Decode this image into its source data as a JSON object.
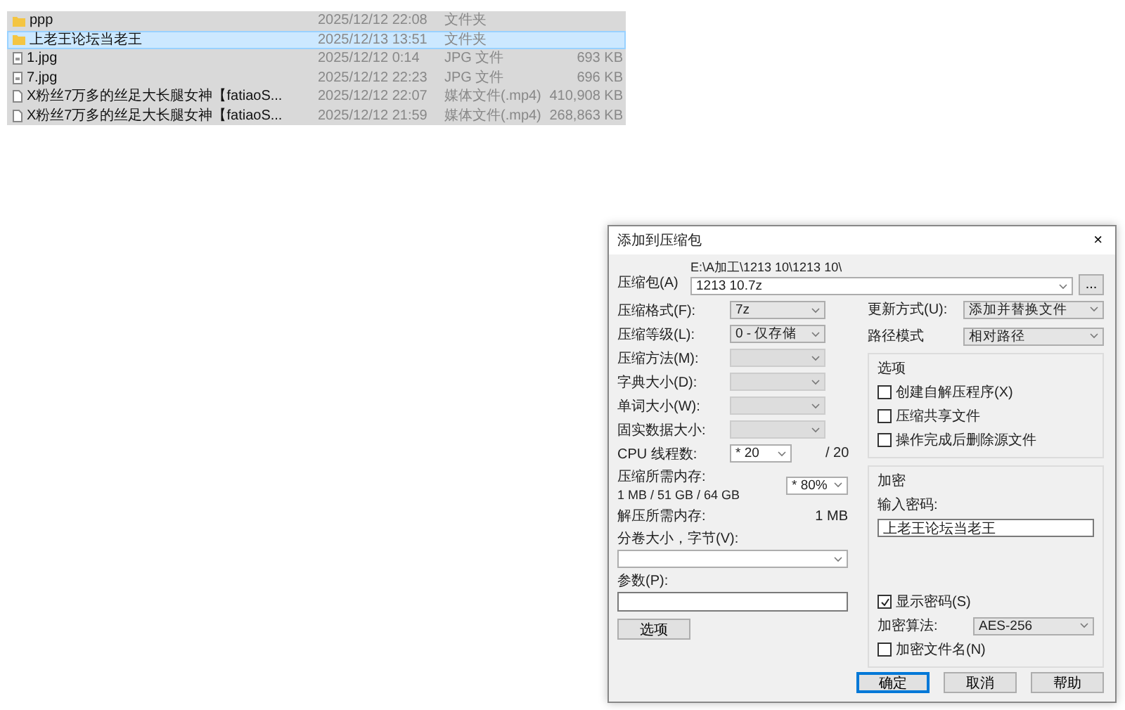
{
  "file_list": {
    "rows": [
      {
        "kind": "folder",
        "name": "ppp",
        "date": "2025/12/12 22:08",
        "type": "文件夹",
        "selected": false
      },
      {
        "kind": "folder",
        "name": "上老王论坛当老王",
        "date": "2025/12/13 13:51",
        "type": "文件夹",
        "selected": true
      },
      {
        "kind": "image",
        "name": "1.jpg",
        "date": "2025/12/12 0:14",
        "type": "JPG 文件",
        "size": "693 KB",
        "selected": false
      },
      {
        "kind": "image",
        "name": "7.jpg",
        "date": "2025/12/12 22:23",
        "type": "JPG 文件",
        "size": "696 KB",
        "selected": false
      },
      {
        "kind": "file",
        "name": "X粉丝7万多的丝足大长腿女神【fatiaoS...",
        "date": "2025/12/12 22:07",
        "type": "媒体文件(.mp4)",
        "size": "410,908 KB",
        "selected": false
      },
      {
        "kind": "file",
        "name": "X粉丝7万多的丝足大长腿女神【fatiaoS...",
        "date": "2025/12/12 21:59",
        "type": "媒体文件(.mp4)",
        "size": "268,863 KB",
        "selected": false
      }
    ]
  },
  "dialog": {
    "title": "添加到压缩包",
    "close": "×",
    "archive": {
      "label": "压缩包(A)",
      "path": "E:\\A加工\\1213 10\\1213 10\\",
      "value": "1213 10.7z",
      "browse": "..."
    },
    "settings": [
      {
        "kind": "combo",
        "label": "压缩格式(F):",
        "value": "7z",
        "disabled": false
      },
      {
        "kind": "combo",
        "label": "压缩等级(L):",
        "value": "0 - 仅存储",
        "disabled": false
      },
      {
        "kind": "combo",
        "label": "压缩方法(M):",
        "disabled": true
      },
      {
        "kind": "combo",
        "label": "字典大小(D):",
        "disabled": true
      },
      {
        "kind": "combo",
        "label": "单词大小(W):",
        "disabled": true
      },
      {
        "kind": "combo",
        "label": "固实数据大小:",
        "disabled": true
      },
      {
        "kind": "threads",
        "label": "CPU 线程数:",
        "value": "* 20",
        "suffix": "/ 20"
      },
      {
        "kind": "memory",
        "label": "压缩所需内存:",
        "note": "1 MB / 51 GB / 64 GB",
        "value": "* 80%"
      },
      {
        "kind": "text",
        "label": "解压所需内存:",
        "value": "1 MB"
      },
      {
        "kind": "wide_combo",
        "label": "分卷大小，字节(V):"
      },
      {
        "kind": "wide_input",
        "label": "参数(P):"
      }
    ],
    "options_button": "选项",
    "update": {
      "label": "更新方式(U):",
      "value": "添加并替换文件"
    },
    "path_mode": {
      "label": "路径模式",
      "value": "相对路径"
    },
    "options_group": {
      "title": "选项",
      "items": [
        {
          "label": "创建自解压程序(X)",
          "checked": false
        },
        {
          "label": "压缩共享文件",
          "checked": false
        },
        {
          "label": "操作完成后删除源文件",
          "checked": false
        }
      ]
    },
    "encryption": {
      "title": "加密",
      "password_label": "输入密码:",
      "password": "上老王论坛当老王",
      "show_password": {
        "label": "显示密码(S)",
        "checked": true
      },
      "method_label": "加密算法:",
      "method": "AES-256",
      "encrypt_names": {
        "label": "加密文件名(N)",
        "checked": false
      }
    },
    "buttons": [
      {
        "label": "确定",
        "default": true
      },
      {
        "label": "取消",
        "default": false
      },
      {
        "label": "帮助",
        "default": false
      }
    ]
  }
}
